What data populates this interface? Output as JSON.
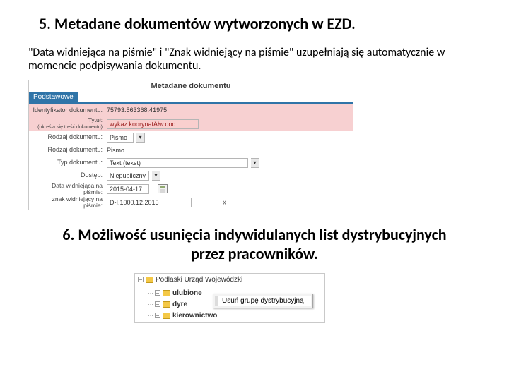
{
  "section5": {
    "heading": "5. Metadane dokumentów wytworzonych w EZD.",
    "description": "\"Data widniejąca na piśmie\" i \"Znak widniejący na piśmie\" uzupełniają się automatycznie w momencie  podpisywania dokumentu."
  },
  "metadata_panel": {
    "title": "Metadane dokumentu",
    "tab": "Podstawowe",
    "rows": {
      "id_label": "Identyfikator dokumentu:",
      "id_value": "75793.563368.41975",
      "tytul_label": "Tytuł:",
      "tytul_sublabel": "(określa się treść dokumentu)",
      "tytul_value": "wykaz koorynatÃłw.doc",
      "rodzaj_dok1_label": "Rodzaj dokumentu:",
      "rodzaj_dok1_value": "Pismo",
      "rodzaj_dok2_label": "Rodzaj dokumentu:",
      "rodzaj_dok2_value": "Pismo",
      "typ_label": "Typ dokumentu:",
      "typ_value": "Text (tekst)",
      "dostep_label": "Dostęp:",
      "dostep_value": "Niepubliczny",
      "data_label": "Data widniejąca na piśmie:",
      "data_value": "2015-04-17",
      "znak_label": "znak widniejący na piśmie:",
      "znak_value": "D-I.1000.12.2015"
    }
  },
  "section6": {
    "heading": "6. Możliwość usunięcia indywidulanych list dystrybucyjnych przez pracowników."
  },
  "tree_panel": {
    "root": "Podlaski Urząd Wojewódzki",
    "items": {
      "ulubione": "ulubione",
      "dyre": "dyre",
      "kierownictwo": "kierownictwo"
    },
    "context_menu": "Usuń grupę dystrybucyjną",
    "minus": "−"
  }
}
